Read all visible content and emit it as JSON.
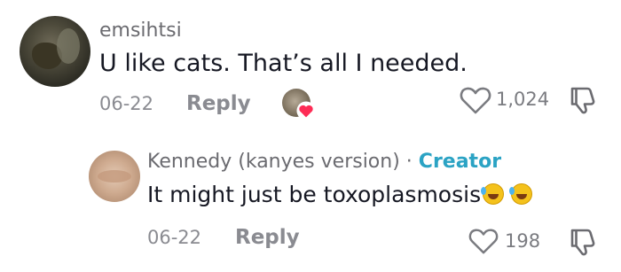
{
  "comments": [
    {
      "username": "emsihtsi",
      "text": "U like cats. That’s all I needed.",
      "date": "06-22",
      "reply_label": "Reply",
      "likes": "1,024",
      "icons": {
        "like": "heart-outline-icon",
        "dislike": "thumbs-down-icon",
        "creator_liked": "creator-liked-heart-icon"
      }
    }
  ],
  "reply": {
    "username": "Kennedy (kanyes version)",
    "separator": "·",
    "badge": "Creator",
    "text": "It might just be toxoplasmosis",
    "emojis": [
      "rolling-on-floor-laughing-emoji",
      "rolling-on-floor-laughing-emoji"
    ],
    "date": "06-22",
    "reply_label": "Reply",
    "likes": "198",
    "icons": {
      "like": "heart-outline-icon",
      "dislike": "thumbs-down-icon"
    }
  },
  "colors": {
    "username": "#6b6b70",
    "text": "#161823",
    "meta": "#8a8b91",
    "creator": "#2ba3c4",
    "liked_heart": "#fe2c55"
  }
}
